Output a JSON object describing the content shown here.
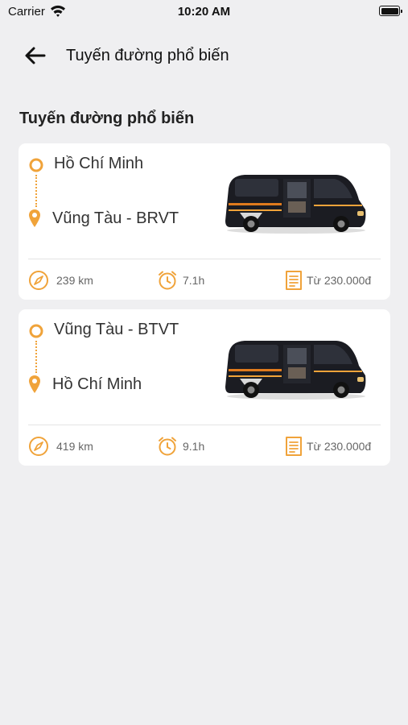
{
  "status_bar": {
    "carrier": "Carrier",
    "time": "10:20 AM"
  },
  "header": {
    "title": "Tuyến đường phổ biến"
  },
  "section": {
    "title": "Tuyến đường phổ biến"
  },
  "routes": [
    {
      "origin": "Hồ Chí Minh",
      "destination": "Vũng Tàu - BRVT",
      "distance": "239 km",
      "duration": "7.1h",
      "price": "Từ  230.000đ"
    },
    {
      "origin": "Vũng Tàu - BTVT",
      "destination": "Hồ Chí Minh",
      "distance": "419 km",
      "duration": "9.1h",
      "price": "Từ  230.000đ"
    }
  ],
  "colors": {
    "accent": "#f0a33a",
    "background": "#efeff1",
    "card": "#ffffff"
  },
  "icons": [
    "wifi-icon",
    "battery-icon",
    "back-arrow-icon",
    "origin-circle-icon",
    "destination-pin-icon",
    "compass-icon",
    "alarm-clock-icon",
    "ticket-icon"
  ]
}
